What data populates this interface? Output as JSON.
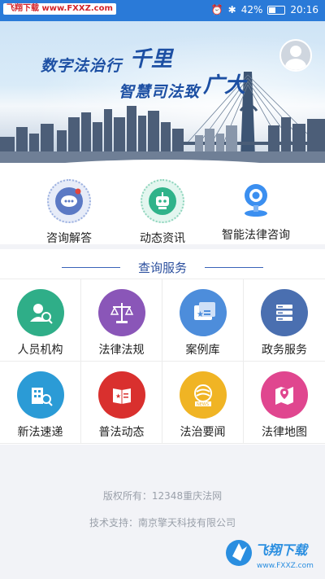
{
  "status_bar": {
    "watermark": "飞翔下载 www.FXXZ.com",
    "battery_percent": "42%",
    "time": "20:16"
  },
  "banner": {
    "slogan_line1": "数字法治行",
    "slogan_line1_big": "千里",
    "slogan_line2": "智慧司法致",
    "slogan_line2_big": "广大"
  },
  "quick_actions": [
    {
      "label": "咨询解答",
      "icon": "chat-bubble-icon",
      "color": "#5b79c4"
    },
    {
      "label": "动态资讯",
      "icon": "robot-icon",
      "color": "#30b38a"
    },
    {
      "label": "智能法律咨询",
      "icon": "webcam-icon",
      "color": "#3b8ff0"
    }
  ],
  "query_section": {
    "title": "查询服务",
    "items": [
      {
        "label": "人员机构",
        "icon": "person-search-icon",
        "color": "#2fae88"
      },
      {
        "label": "法律法规",
        "icon": "scales-icon",
        "color": "#8a56b8"
      },
      {
        "label": "案例库",
        "icon": "case-file-icon",
        "color": "#4d8ddb"
      },
      {
        "label": "政务服务",
        "icon": "server-list-icon",
        "color": "#4a6fb0"
      },
      {
        "label": "新法速递",
        "icon": "building-search-icon",
        "color": "#2b9bd6"
      },
      {
        "label": "普法动态",
        "icon": "book-star-icon",
        "color": "#d9302e"
      },
      {
        "label": "法治要闻",
        "icon": "news-icon",
        "color": "#f0b424"
      },
      {
        "label": "法律地图",
        "icon": "map-pin-icon",
        "color": "#e0468f"
      }
    ]
  },
  "footer": {
    "copyright": "版权所有：12348重庆法网",
    "support": "技术支持：南京擎天科技有限公司"
  },
  "brand_watermark": {
    "name": "飞翔下载",
    "url": "www.FXXZ.com"
  }
}
